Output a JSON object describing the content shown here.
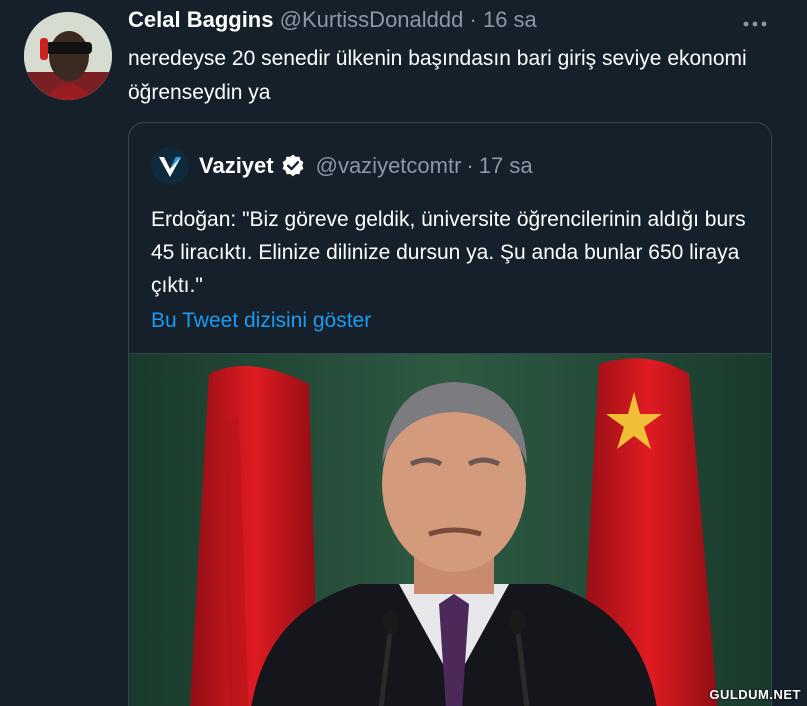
{
  "tweet": {
    "display_name": "Celal Baggins",
    "handle": "@KurtissDonalddd",
    "separator": "·",
    "time": "16 sa",
    "text": "neredeyse 20 senedir ülkenin başındasın bari giriş seviye ekonomi öğrenseydin ya"
  },
  "quoted": {
    "display_name": "Vaziyet",
    "handle": "@vaziyetcomtr",
    "separator": "·",
    "time": "17 sa",
    "text": "Erdoğan: \"Biz göreve geldik, üniversite öğrencilerinin aldığı burs 45 liracıktı. Elinize dilinize dursun ya. Şu anda bunlar 650 liraya çıktı.\"",
    "thread_link": "Bu Tweet dizisini göster"
  },
  "icons": {
    "more": "more-options-icon",
    "verified": "verified-badge-icon",
    "logo": "vaziyet-logo-icon"
  },
  "watermark": "GULDUM.NET",
  "colors": {
    "background": "#15202b",
    "secondary_text": "#8b98a5",
    "link": "#1d9bf0",
    "border": "#38444d"
  }
}
